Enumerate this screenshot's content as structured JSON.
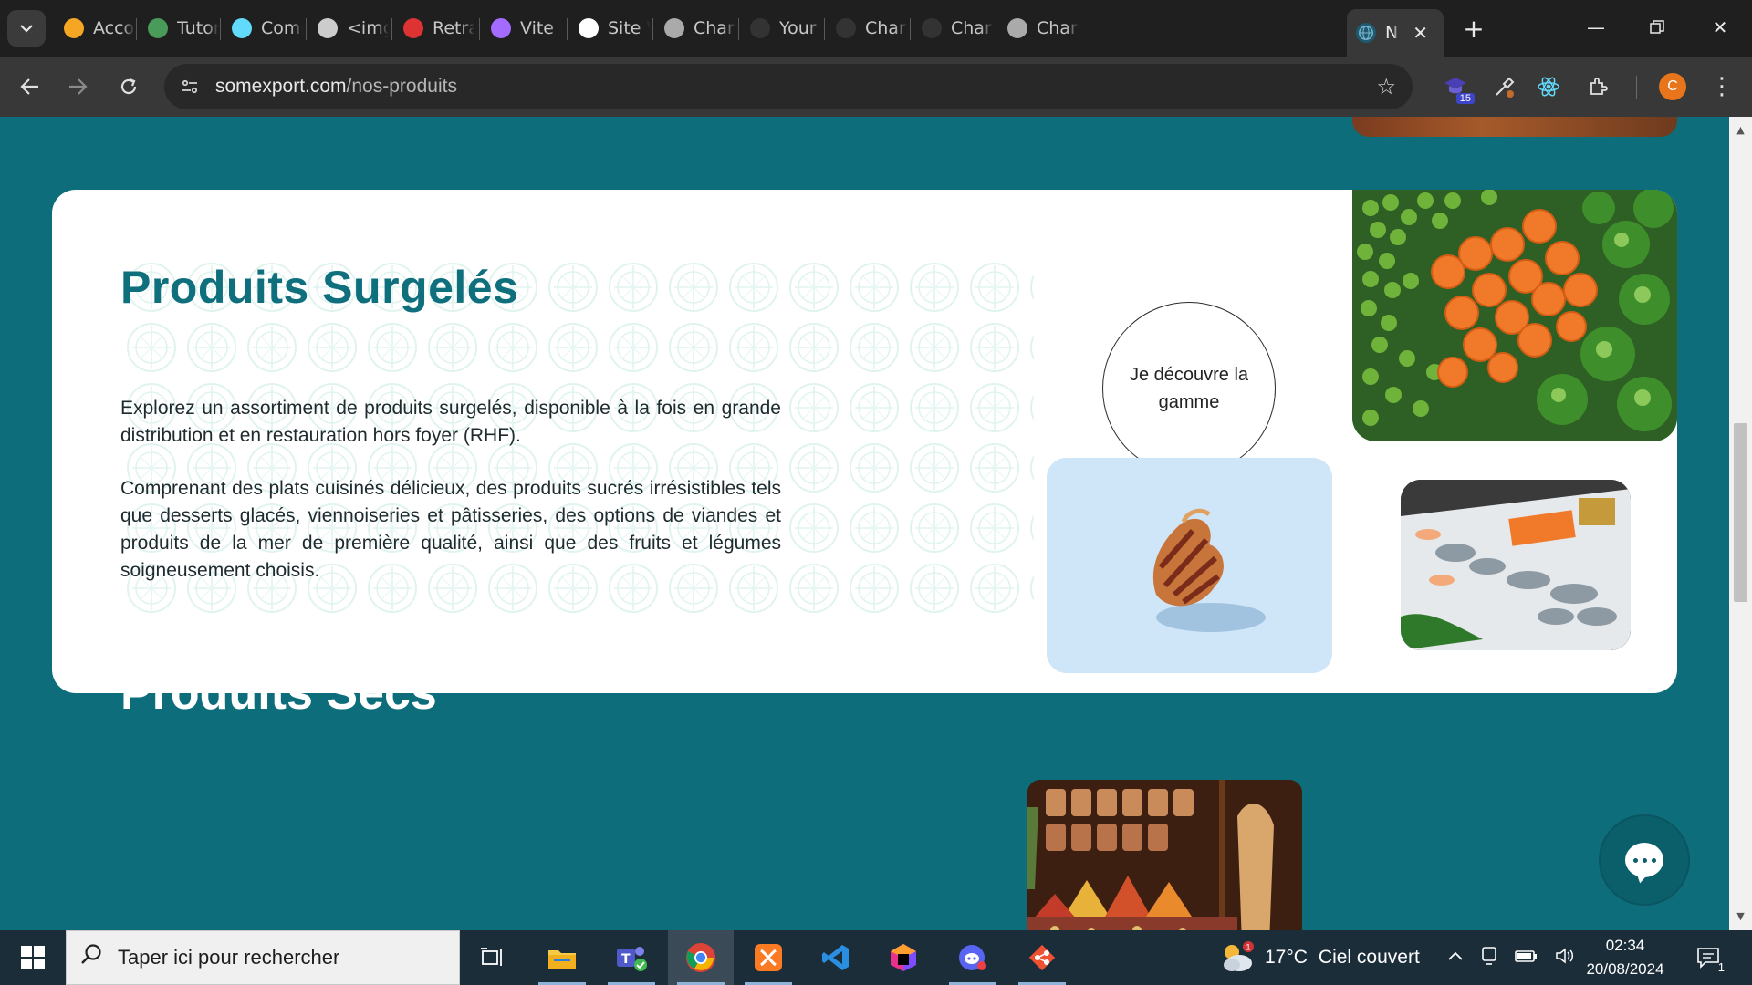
{
  "browser": {
    "tabs": [
      {
        "label": "Accou",
        "icon": "flame-icon",
        "color": "#f5a623"
      },
      {
        "label": "Tutori",
        "icon": "w-logo-icon",
        "color": "#4a9a5a"
      },
      {
        "label": "Comp",
        "icon": "react-icon",
        "color": "#61dafb"
      },
      {
        "label": "<img",
        "icon": "m-logo-icon",
        "color": "#cccccc"
      },
      {
        "label": "Retrai",
        "icon": "flag-icon",
        "color": "#d33"
      },
      {
        "label": "Vite +",
        "icon": "vite-icon",
        "color": "#a36bff"
      },
      {
        "label": "Site W",
        "icon": "openai-icon",
        "color": "#ffffff"
      },
      {
        "label": "Charle",
        "icon": "globe-icon",
        "color": "#aaaaaa"
      },
      {
        "label": "Your F",
        "icon": "github-icon",
        "color": "#333333"
      },
      {
        "label": "Charle",
        "icon": "github-icon",
        "color": "#333333"
      },
      {
        "label": "Charle",
        "icon": "github-icon",
        "color": "#333333"
      },
      {
        "label": "Charle",
        "icon": "globe-icon",
        "color": "#aaaaaa"
      }
    ],
    "active_tab": {
      "label": "N",
      "icon": "globe-icon"
    },
    "url_host": "somexport.com",
    "url_path": "/nos-produits",
    "extension_badge": "15",
    "profile_initial": "C"
  },
  "page": {
    "frozen": {
      "title": "Produits Surgelés",
      "paragraph1": "Explorez un assortiment de produits surgelés, disponible à la fois en grande distribution et en restauration hors foyer (RHF).",
      "paragraph2": "Comprenant des plats cuisinés délicieux, des produits sucrés irrésistibles tels que desserts glacés, viennoiseries et pâtisseries, des options de viandes et produits de la mer de première qualité, ainsi que des fruits et légumes soigneusement choisis.",
      "cta": "Je découvre la gamme"
    },
    "dry": {
      "title": "Produits Secs"
    }
  },
  "taskbar": {
    "search_placeholder": "Taper ici pour rechercher",
    "weather_temp": "17°C",
    "weather_desc": "Ciel couvert",
    "time": "02:34",
    "date": "20/08/2024",
    "notification_count": "1"
  },
  "colors": {
    "page_bg": "#0d6d7a",
    "title_teal": "#0f6f7d",
    "card_bg": "#ffffff"
  }
}
